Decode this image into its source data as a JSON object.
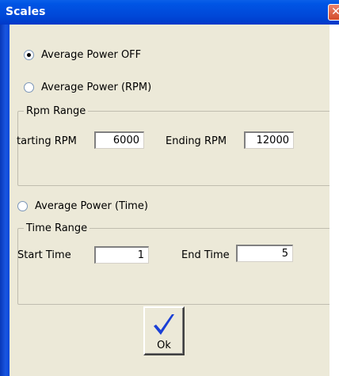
{
  "window": {
    "title": "Scales",
    "close_glyph": "✕"
  },
  "mode": {
    "options": [
      {
        "label": "Average Power OFF",
        "checked": true
      },
      {
        "label": "Average Power (RPM)",
        "checked": false
      },
      {
        "label": "Average Power (Time)",
        "checked": false
      }
    ]
  },
  "rpm_range": {
    "legend": "Rpm Range",
    "starting_label": "tarting RPM",
    "starting_value": "6000",
    "ending_label": "Ending RPM",
    "ending_value": "12000"
  },
  "time_range": {
    "legend": "Time Range",
    "start_label": "Start Time",
    "start_value": "1",
    "end_label": "End Time",
    "end_value": "5"
  },
  "ok_button": {
    "label": "Ok",
    "icon": "checkmark-icon",
    "icon_color": "#1a3fd6"
  }
}
